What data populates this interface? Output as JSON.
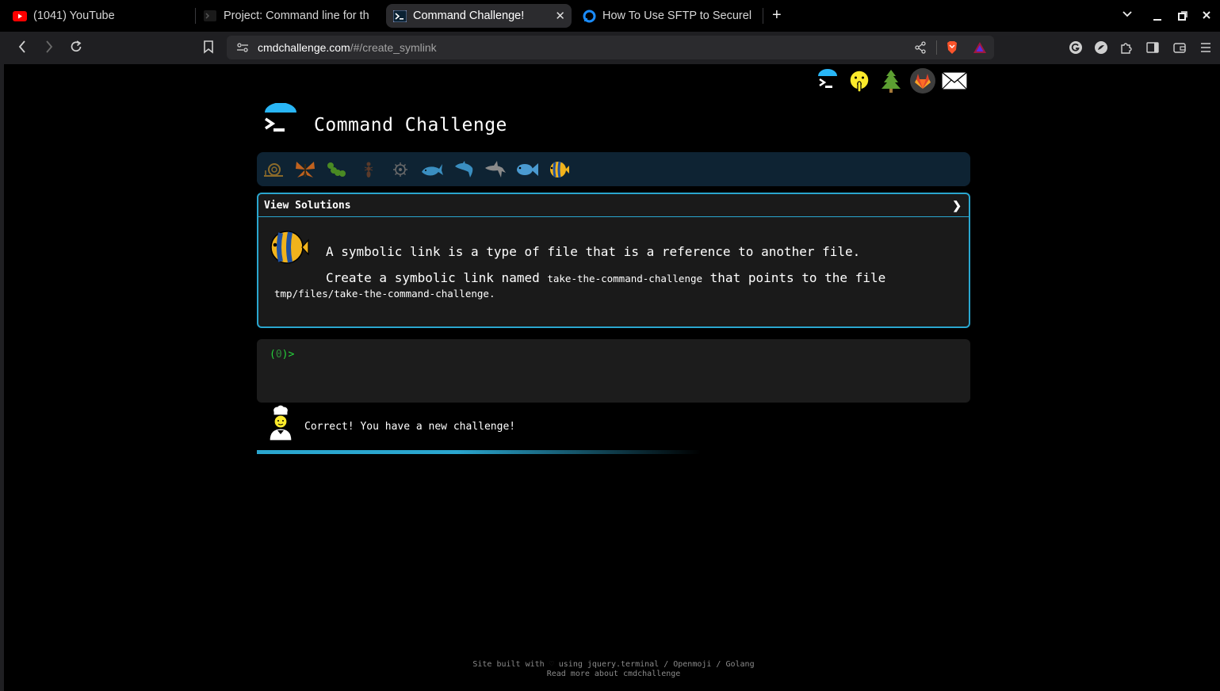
{
  "browser": {
    "tabs": [
      {
        "label": "(1041) YouTube",
        "icon": "youtube-icon",
        "active": false
      },
      {
        "label": "Project: Command line for th",
        "icon": "terminal-icon",
        "active": false
      },
      {
        "label": "Command Challenge!",
        "icon": "terminal-icon",
        "active": true
      },
      {
        "label": "How To Use SFTP to Securel",
        "icon": "digitalocean-icon",
        "active": false
      }
    ],
    "url_domain": "cmdchallenge.com",
    "url_path": "/#/create_symlink",
    "accent": "#2aa6cf"
  },
  "header": {
    "title": "Command Challenge"
  },
  "challenge": {
    "view_solutions_label": "View Solutions",
    "chevron": "❯",
    "line1": "A symbolic link is a type of file that is a reference to another file.",
    "line2_prefix": "Create a symbolic link named ",
    "line2_code": "take-the-command-challenge",
    "line2_suffix": " that points to the file",
    "line3_code": "tmp/files/take-the-command-challenge",
    "line3_suffix": "."
  },
  "terminal": {
    "prompt_open": "(",
    "prompt_num": "0",
    "prompt_close": ")>"
  },
  "status": {
    "message": "Correct! You have a new challenge!"
  },
  "footer": {
    "line1_prefix": "Site built with ",
    "heart": "♡",
    "line1_suffix": " using jquery.terminal / Openmoji / Golang",
    "line2": "Read more about cmdchallenge"
  }
}
